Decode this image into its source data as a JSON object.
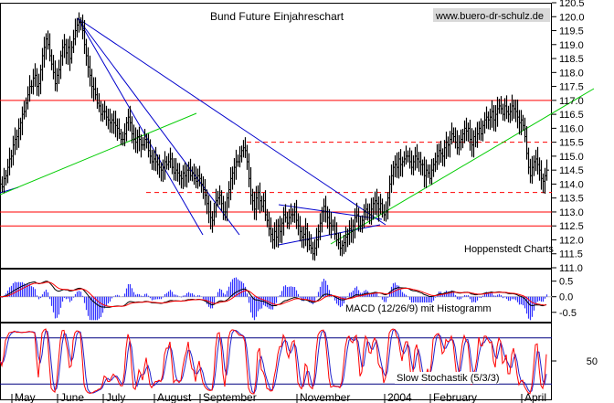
{
  "chart_data": {
    "type": "line",
    "title": "Bund Future Einjahreschart",
    "website": "www.buero-dr-schulz.de",
    "source_label": "Hoppenstedt Charts",
    "x_labels": [
      "May",
      "June",
      "July",
      "August",
      "September",
      "November",
      "2004",
      "February",
      "April"
    ],
    "price": {
      "ylim": [
        111.0,
        120.5
      ],
      "ticks": [
        "120.5",
        "120.0",
        "119.5",
        "119.0",
        "118.5",
        "118.0",
        "117.5",
        "117.0",
        "116.5",
        "116.0",
        "115.5",
        "115.0",
        "114.5",
        "114.0",
        "113.5",
        "113.0",
        "112.5",
        "112.0",
        "111.5",
        "111.0"
      ],
      "series": [
        [
          0,
          114.0
        ],
        [
          2,
          113.9
        ],
        [
          4,
          114.2
        ],
        [
          6,
          114.3
        ],
        [
          8,
          114.6
        ],
        [
          10,
          114.9
        ],
        [
          12,
          115.0
        ],
        [
          14,
          115.4
        ],
        [
          16,
          115.6
        ],
        [
          18,
          115.7
        ],
        [
          20,
          116.0
        ],
        [
          22,
          116.2
        ],
        [
          24,
          116.5
        ],
        [
          26,
          116.6
        ],
        [
          28,
          116.9
        ],
        [
          30,
          117.2
        ],
        [
          32,
          117.5
        ],
        [
          34,
          117.5
        ],
        [
          36,
          117.8
        ],
        [
          38,
          117.9
        ],
        [
          40,
          117.5
        ],
        [
          42,
          117.6
        ],
        [
          44,
          118.1
        ],
        [
          46,
          118.6
        ],
        [
          48,
          118.9
        ],
        [
          50,
          119.2
        ],
        [
          52,
          119.0
        ],
        [
          54,
          118.6
        ],
        [
          56,
          118.3
        ],
        [
          58,
          118.0
        ],
        [
          60,
          117.6
        ],
        [
          62,
          117.9
        ],
        [
          64,
          118.1
        ],
        [
          66,
          118.6
        ],
        [
          68,
          118.9
        ],
        [
          70,
          119.0
        ],
        [
          72,
          118.7
        ],
        [
          74,
          118.9
        ],
        [
          76,
          118.5
        ],
        [
          78,
          118.9
        ],
        [
          80,
          119.2
        ],
        [
          82,
          119.5
        ],
        [
          84,
          119.7
        ],
        [
          86,
          119.8
        ],
        [
          88,
          119.8
        ],
        [
          90,
          119.5
        ],
        [
          92,
          119.0
        ],
        [
          94,
          118.6
        ],
        [
          96,
          118.2
        ],
        [
          98,
          117.9
        ],
        [
          100,
          117.5
        ],
        [
          102,
          117.4
        ],
        [
          104,
          117.2
        ],
        [
          106,
          116.9
        ],
        [
          108,
          116.8
        ],
        [
          110,
          116.5
        ],
        [
          112,
          116.6
        ],
        [
          114,
          116.6
        ],
        [
          116,
          116.4
        ],
        [
          118,
          116.3
        ],
        [
          120,
          116.2
        ],
        [
          122,
          116.3
        ],
        [
          124,
          116.2
        ],
        [
          126,
          116.1
        ],
        [
          128,
          116.0
        ],
        [
          130,
          115.8
        ],
        [
          132,
          115.6
        ],
        [
          134,
          115.6
        ],
        [
          136,
          115.8
        ],
        [
          138,
          116.2
        ],
        [
          140,
          116.4
        ],
        [
          142,
          116.2
        ],
        [
          144,
          115.8
        ],
        [
          146,
          115.6
        ],
        [
          148,
          115.5
        ],
        [
          150,
          115.7
        ],
        [
          152,
          115.6
        ],
        [
          154,
          115.4
        ],
        [
          156,
          115.4
        ],
        [
          158,
          115.6
        ],
        [
          160,
          115.5
        ],
        [
          162,
          115.2
        ],
        [
          164,
          115.0
        ],
        [
          166,
          114.8
        ],
        [
          168,
          114.9
        ],
        [
          170,
          114.8
        ],
        [
          172,
          114.7
        ],
        [
          174,
          114.6
        ],
        [
          176,
          114.5
        ],
        [
          178,
          114.6
        ],
        [
          180,
          114.8
        ],
        [
          182,
          114.7
        ],
        [
          184,
          114.8
        ],
        [
          186,
          114.9
        ],
        [
          188,
          114.6
        ],
        [
          190,
          114.4
        ],
        [
          192,
          114.5
        ],
        [
          194,
          114.4
        ],
        [
          196,
          114.3
        ],
        [
          198,
          114.2
        ],
        [
          200,
          114.4
        ],
        [
          202,
          114.3
        ],
        [
          204,
          114.5
        ],
        [
          206,
          114.5
        ],
        [
          208,
          114.3
        ],
        [
          210,
          114.4
        ],
        [
          212,
          114.2
        ],
        [
          214,
          114.1
        ],
        [
          216,
          114.3
        ],
        [
          218,
          114.2
        ],
        [
          220,
          114.0
        ],
        [
          222,
          113.8
        ],
        [
          224,
          113.6
        ],
        [
          226,
          113.3
        ],
        [
          228,
          113.0
        ],
        [
          230,
          112.8
        ],
        [
          232,
          112.7
        ],
        [
          234,
          113.0
        ],
        [
          236,
          113.4
        ],
        [
          238,
          113.5
        ],
        [
          240,
          113.6
        ],
        [
          242,
          113.3
        ],
        [
          244,
          113.0
        ],
        [
          246,
          113.0
        ],
        [
          248,
          113.5
        ],
        [
          250,
          113.8
        ],
        [
          252,
          114.2
        ],
        [
          254,
          114.4
        ],
        [
          256,
          114.6
        ],
        [
          258,
          114.8
        ],
        [
          260,
          114.8
        ],
        [
          262,
          115.0
        ],
        [
          264,
          115.2
        ],
        [
          266,
          115.3
        ],
        [
          268,
          115.2
        ],
        [
          270,
          114.8
        ],
        [
          272,
          114.2
        ],
        [
          274,
          113.6
        ],
        [
          276,
          113.4
        ],
        [
          278,
          113.1
        ],
        [
          280,
          113.5
        ],
        [
          282,
          113.7
        ],
        [
          284,
          113.4
        ],
        [
          286,
          113.2
        ],
        [
          288,
          113.4
        ],
        [
          290,
          112.9
        ],
        [
          292,
          112.7
        ],
        [
          294,
          112.4
        ],
        [
          296,
          112.2
        ],
        [
          298,
          112.0
        ],
        [
          300,
          112.3
        ],
        [
          302,
          112.1
        ],
        [
          304,
          112.5
        ],
        [
          306,
          112.3
        ],
        [
          308,
          112.6
        ],
        [
          310,
          112.9
        ],
        [
          312,
          112.8
        ],
        [
          314,
          112.6
        ],
        [
          316,
          112.8
        ],
        [
          318,
          112.9
        ],
        [
          320,
          112.9
        ],
        [
          322,
          113.0
        ],
        [
          324,
          112.7
        ],
        [
          326,
          112.5
        ],
        [
          328,
          112.3
        ],
        [
          330,
          112.1
        ],
        [
          332,
          112.2
        ],
        [
          334,
          112.4
        ],
        [
          336,
          112.0
        ],
        [
          338,
          111.8
        ],
        [
          340,
          111.7
        ],
        [
          342,
          111.5
        ],
        [
          344,
          111.7
        ],
        [
          346,
          112.0
        ],
        [
          348,
          112.3
        ],
        [
          350,
          112.6
        ],
        [
          352,
          113.0
        ],
        [
          354,
          113.2
        ],
        [
          356,
          113.0
        ],
        [
          358,
          112.8
        ],
        [
          360,
          112.6
        ],
        [
          362,
          112.5
        ],
        [
          364,
          112.5
        ],
        [
          366,
          112.2
        ],
        [
          368,
          112.0
        ],
        [
          370,
          111.9
        ],
        [
          372,
          111.7
        ],
        [
          374,
          111.8
        ],
        [
          376,
          111.9
        ],
        [
          378,
          112.1
        ],
        [
          380,
          112.2
        ],
        [
          382,
          112.4
        ],
        [
          384,
          112.3
        ],
        [
          386,
          112.5
        ],
        [
          388,
          112.8
        ],
        [
          390,
          112.9
        ],
        [
          392,
          112.5
        ],
        [
          394,
          112.5
        ],
        [
          396,
          112.7
        ],
        [
          398,
          113.0
        ],
        [
          400,
          113.1
        ],
        [
          402,
          113.0
        ],
        [
          404,
          112.9
        ],
        [
          406,
          113.1
        ],
        [
          408,
          113.3
        ],
        [
          410,
          113.4
        ],
        [
          412,
          113.3
        ],
        [
          414,
          113.1
        ],
        [
          416,
          113.3
        ],
        [
          418,
          113.0
        ],
        [
          420,
          112.9
        ],
        [
          422,
          113.0
        ],
        [
          424,
          113.5
        ],
        [
          426,
          114.0
        ],
        [
          428,
          114.3
        ],
        [
          430,
          114.6
        ],
        [
          432,
          114.7
        ],
        [
          434,
          114.6
        ],
        [
          436,
          114.9
        ],
        [
          438,
          114.7
        ],
        [
          440,
          114.8
        ],
        [
          442,
          114.9
        ],
        [
          444,
          115.0
        ],
        [
          446,
          115.0
        ],
        [
          448,
          114.8
        ],
        [
          450,
          114.6
        ],
        [
          452,
          114.8
        ],
        [
          454,
          115.0
        ],
        [
          456,
          114.9
        ],
        [
          458,
          114.8
        ],
        [
          460,
          114.7
        ],
        [
          462,
          114.7
        ],
        [
          464,
          114.3
        ],
        [
          466,
          114.5
        ],
        [
          468,
          114.4
        ],
        [
          470,
          114.2
        ],
        [
          472,
          114.5
        ],
        [
          474,
          114.7
        ],
        [
          476,
          114.8
        ],
        [
          478,
          115.0
        ],
        [
          480,
          115.2
        ],
        [
          482,
          115.1
        ],
        [
          484,
          115.0
        ],
        [
          486,
          115.3
        ],
        [
          488,
          115.5
        ],
        [
          490,
          115.4
        ],
        [
          492,
          115.6
        ],
        [
          494,
          115.8
        ],
        [
          496,
          115.7
        ],
        [
          498,
          115.5
        ],
        [
          500,
          115.3
        ],
        [
          502,
          115.5
        ],
        [
          504,
          115.6
        ],
        [
          506,
          115.8
        ],
        [
          508,
          116.0
        ],
        [
          510,
          115.9
        ],
        [
          512,
          116.0
        ],
        [
          514,
          115.6
        ],
        [
          516,
          115.4
        ],
        [
          518,
          115.7
        ],
        [
          520,
          115.5
        ],
        [
          522,
          115.8
        ],
        [
          524,
          116.0
        ],
        [
          526,
          115.8
        ],
        [
          528,
          116.1
        ],
        [
          530,
          116.3
        ],
        [
          532,
          116.4
        ],
        [
          534,
          116.3
        ],
        [
          536,
          116.4
        ],
        [
          538,
          116.6
        ],
        [
          540,
          116.3
        ],
        [
          542,
          116.5
        ],
        [
          544,
          116.7
        ],
        [
          546,
          116.8
        ],
        [
          548,
          116.7
        ],
        [
          550,
          116.5
        ],
        [
          552,
          116.8
        ],
        [
          554,
          116.6
        ],
        [
          556,
          116.5
        ],
        [
          558,
          116.6
        ],
        [
          560,
          116.8
        ],
        [
          562,
          116.7
        ],
        [
          564,
          116.6
        ],
        [
          566,
          116.4
        ],
        [
          568,
          116.2
        ],
        [
          570,
          116.3
        ],
        [
          572,
          116.1
        ],
        [
          574,
          115.7
        ],
        [
          576,
          115.1
        ],
        [
          578,
          114.6
        ],
        [
          580,
          114.3
        ],
        [
          582,
          114.6
        ],
        [
          584,
          114.8
        ],
        [
          586,
          114.9
        ],
        [
          588,
          114.7
        ],
        [
          590,
          114.5
        ],
        [
          592,
          114.2
        ],
        [
          594,
          114.1
        ],
        [
          596,
          114.3
        ],
        [
          598,
          114.5
        ]
      ]
    },
    "levels": {
      "red_solid": [
        117.0,
        113.0,
        112.5
      ],
      "red_dashed": [
        115.5,
        113.7
      ]
    },
    "macd": {
      "label": "MACD (12/26/9) mit Histogramm",
      "ylim": [
        -0.8,
        0.9
      ],
      "ticks": [
        "0.5",
        "0.0",
        "-0.5"
      ]
    },
    "stochastic": {
      "label": "Slow Stochastik (5/3/3)",
      "ylim": [
        0,
        100
      ],
      "ticks": [
        "50"
      ],
      "levels": [
        80,
        20
      ]
    },
    "colors": {
      "price": "#000000",
      "level_line": "#ff0000",
      "trend_blue": "#0000cc",
      "trend_green": "#00cc00",
      "macd_line": "#000000",
      "macd_signal": "#ff0000",
      "macd_histogram": "#3333ff",
      "stoch_k": "#ff0000",
      "stoch_d": "#2222cc",
      "stoch_level": "#000080",
      "site_box": "#d9d9d9"
    }
  }
}
